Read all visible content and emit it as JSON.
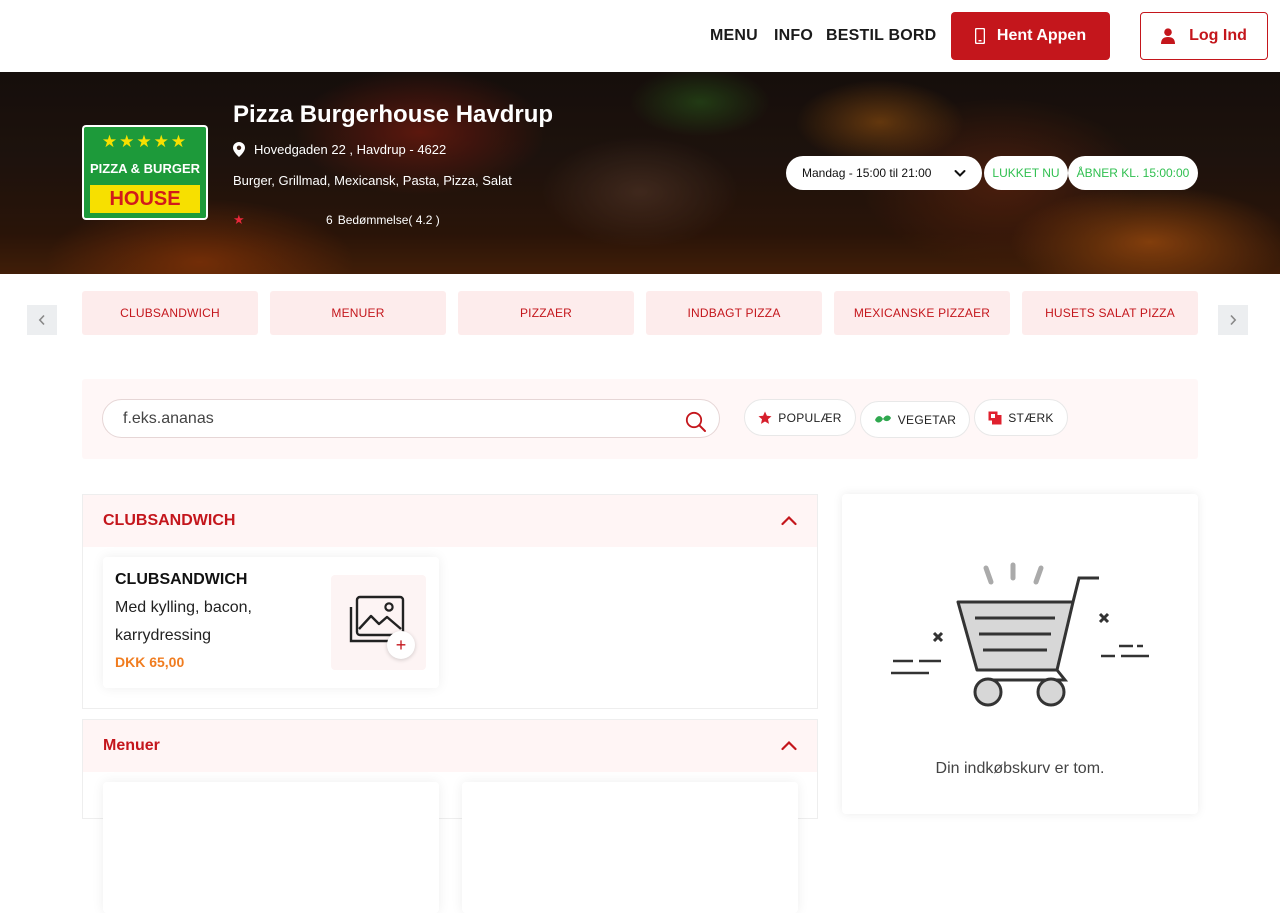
{
  "nav": {
    "links": [
      "MENU",
      "INFO",
      "BESTIL BORD"
    ],
    "app_button": "Hent Appen",
    "login_button": "Log Ind"
  },
  "restaurant": {
    "logo_text_1": "PIZZA & BURGER",
    "logo_text_2": "HOUSE",
    "name": "Pizza Burgerhouse Havdrup",
    "address": "Hovedgaden 22 , Havdrup - 4622",
    "cuisine": "Burger, Grillmad, Mexicansk, Pasta, Pizza, Salat",
    "rating_count": "6",
    "rating_label": "Bedømmelse( 4.2 )",
    "rating_value": 4.2,
    "hours_selected": "Mandag - 15:00 til 21:00",
    "status": "LUKKET NU",
    "opens_at": "ÅBNER KL. 15:00:00"
  },
  "categories": [
    "CLUBSANDWICH",
    "MENUER",
    "PIZZAER",
    "INDBAGT PIZZA",
    "MEXICANSKE PIZZAER",
    "HUSETS SALAT PIZZA"
  ],
  "search": {
    "placeholder": "f.eks.ananas",
    "filters": [
      "POPULÆR",
      "VEGETAR",
      "STÆRK"
    ]
  },
  "sections": [
    {
      "title": "CLUBSANDWICH",
      "items": [
        {
          "name": "CLUBSANDWICH",
          "description": "Med kylling, bacon, karrydressing",
          "price": "DKK 65,00"
        }
      ]
    },
    {
      "title": "Menuer"
    }
  ],
  "cart": {
    "empty_text": "Din indkøbskurv er tom."
  },
  "colors": {
    "brand_red": "#c4161c",
    "price_orange": "#f07c1f",
    "status_green": "#2fbf4f"
  }
}
